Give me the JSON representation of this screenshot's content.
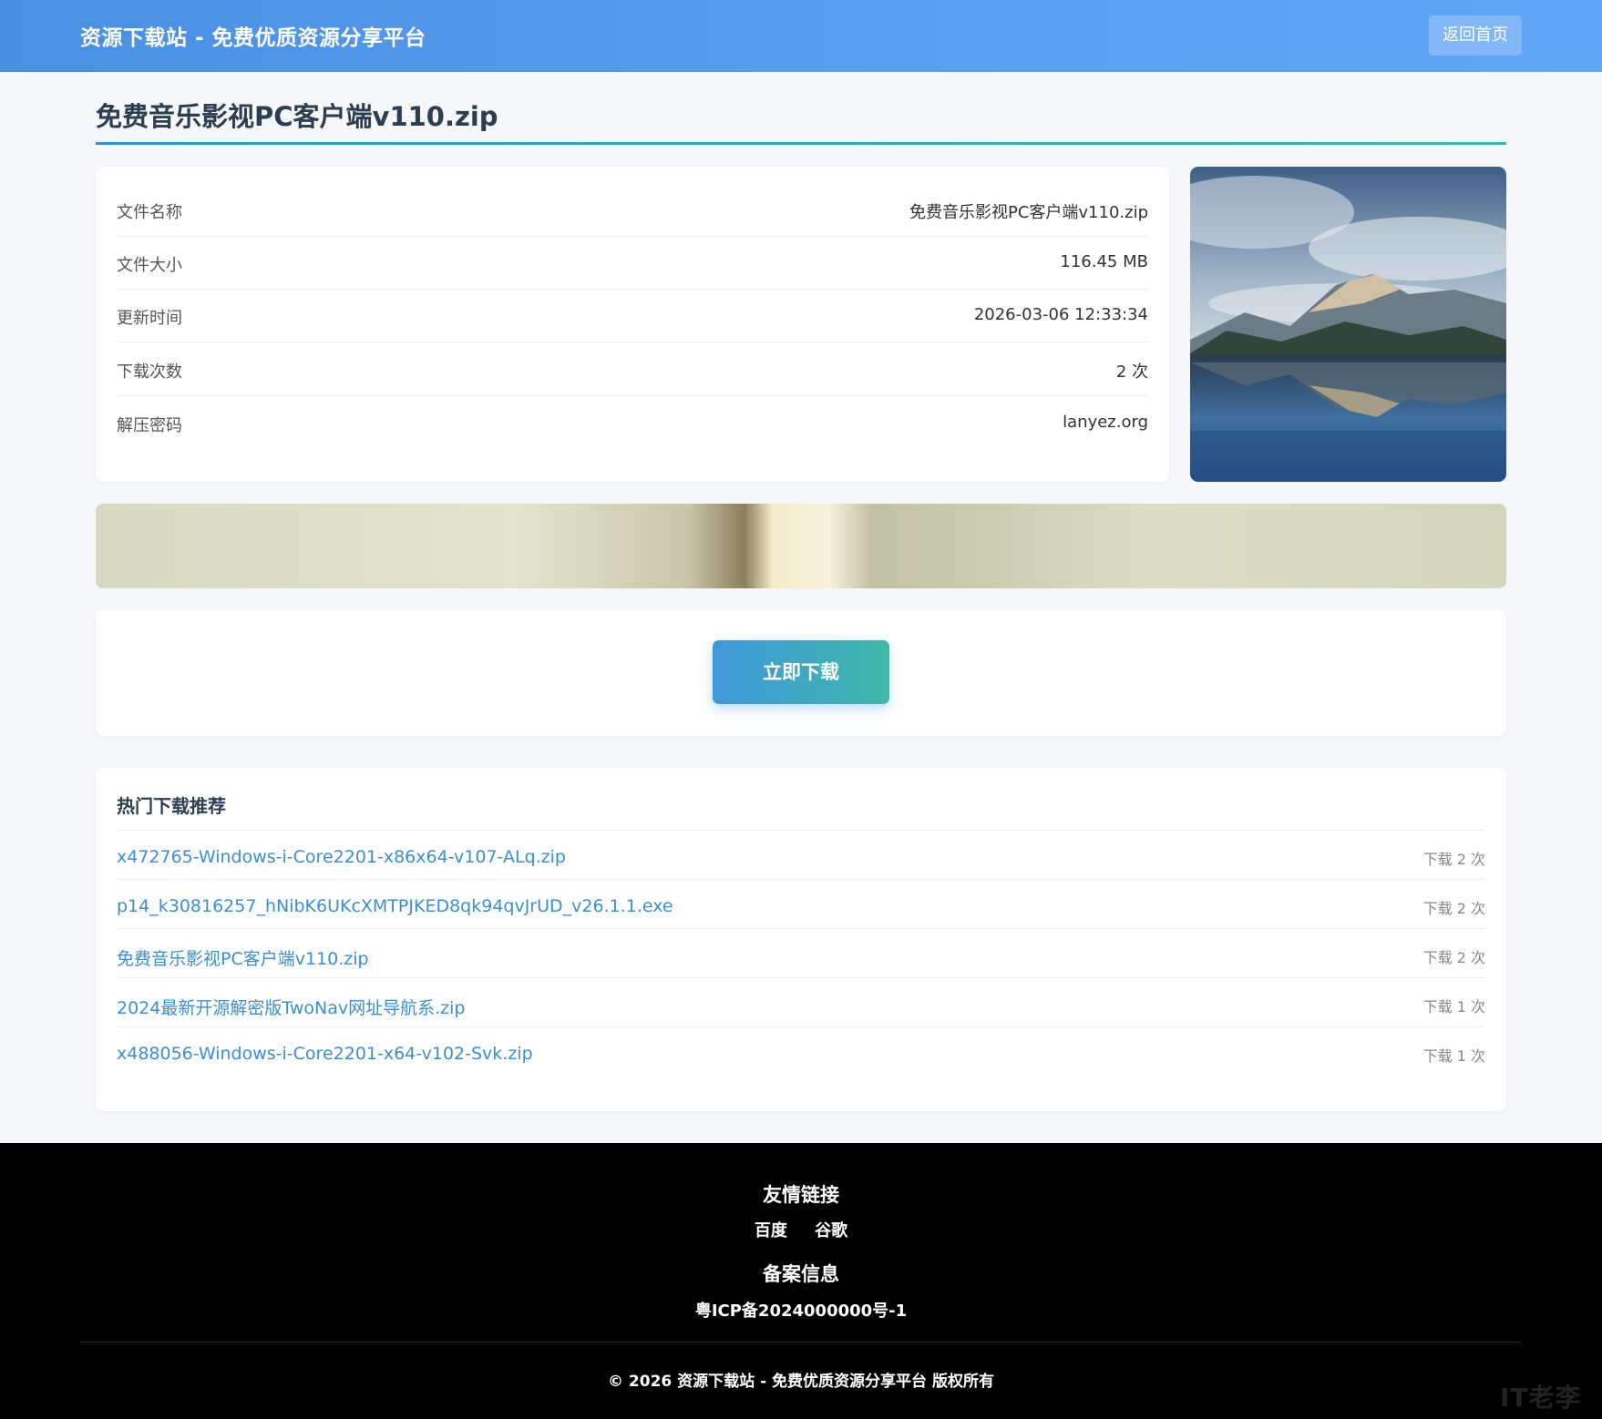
{
  "header": {
    "site_title": "资源下载站 - 免费优质资源分享平台",
    "home_button": "返回首页"
  },
  "file": {
    "title": "免费音乐影视PC客户端v110.zip",
    "rows": [
      {
        "label": "文件名称",
        "value": "免费音乐影视PC客户端v110.zip"
      },
      {
        "label": "文件大小",
        "value": "116.45 MB"
      },
      {
        "label": "更新时间",
        "value": "2026-03-06 12:33:34"
      },
      {
        "label": "下载次数",
        "value": "2 次"
      },
      {
        "label": "解压密码",
        "value": "lanyez.org"
      }
    ]
  },
  "download": {
    "button": "立即下载"
  },
  "hot": {
    "title": "热门下载推荐",
    "items": [
      {
        "name": "x472765-Windows-i-Core2201-x86x64-v107-ALq.zip",
        "count": "下载 2 次"
      },
      {
        "name": "p14_k30816257_hNibK6UKcXMTPJKED8qk94qvJrUD_v26.1.1.exe",
        "count": "下载 2 次"
      },
      {
        "name": "免费音乐影视PC客户端v110.zip",
        "count": "下载 2 次"
      },
      {
        "name": "2024最新开源解密版TwoNav网址导航系.zip",
        "count": "下载 1 次"
      },
      {
        "name": "x488056-Windows-i-Core2201-x64-v102-Svk.zip",
        "count": "下载 1 次"
      }
    ]
  },
  "footer": {
    "links_title": "友情链接",
    "links": [
      "百度",
      "谷歌"
    ],
    "icp_title": "备案信息",
    "icp": "粤ICP备2024000000号-1",
    "copyright": "© 2026 资源下载站 - 免费优质资源分享平台 版权所有",
    "watermark": "IT老李"
  },
  "colors": {
    "header": "#5b9ff2",
    "accent": "#3a8fd4",
    "accent2": "#3fb8a8",
    "footer_bg": "#000000"
  }
}
